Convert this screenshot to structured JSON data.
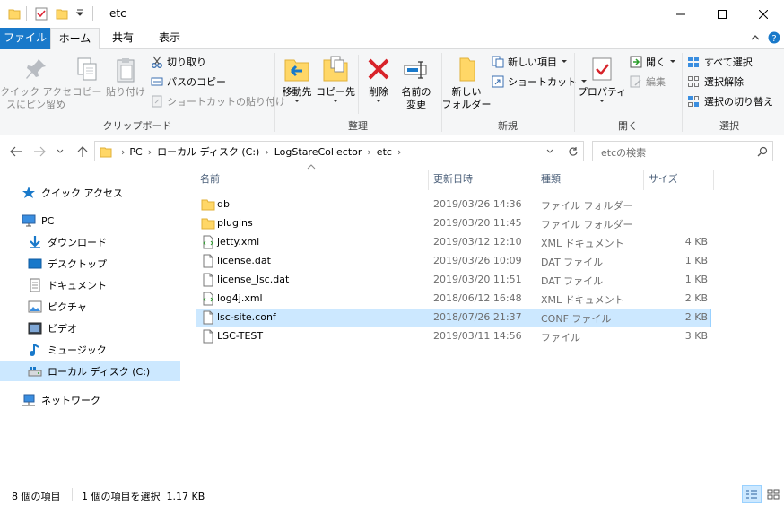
{
  "window": {
    "title": "etc"
  },
  "tabs": [
    "ファイル",
    "ホーム",
    "共有",
    "表示"
  ],
  "ribbon": {
    "clipboard": {
      "pin": "クイック アクセス\nスにピン留め",
      "pin_line1": "クイック アクセ",
      "pin_line2": "スにピン留め",
      "copy": "コピー",
      "paste": "貼り付け",
      "cut": "切り取り",
      "copy_path": "パスのコピー",
      "paste_shortcut": "ショートカットの貼り付け",
      "label": "クリップボード"
    },
    "organize": {
      "move_to": "移動先",
      "copy_to": "コピー先",
      "delete": "削除",
      "rename_line1": "名前の",
      "rename_line2": "変更",
      "label": "整理"
    },
    "new": {
      "new_folder_line1": "新しい",
      "new_folder_line2": "フォルダー",
      "new_item": "新しい項目",
      "shortcut": "ショートカット",
      "label": "新規"
    },
    "open": {
      "properties": "プロパティ",
      "open": "開く",
      "edit": "編集",
      "label": "開く"
    },
    "select": {
      "select_all": "すべて選択",
      "select_none": "選択解除",
      "invert": "選択の切り替え",
      "label": "選択"
    }
  },
  "address": {
    "crumbs": [
      "PC",
      "ローカル ディスク (C:)",
      "LogStareCollector",
      "etc"
    ],
    "search_placeholder": "etcの検索"
  },
  "sidebar": {
    "items": [
      {
        "label": "クイック アクセス",
        "icon": "star-icon"
      },
      {
        "label": "PC",
        "icon": "pc-icon"
      },
      {
        "label": "ダウンロード",
        "icon": "download-icon"
      },
      {
        "label": "デスクトップ",
        "icon": "desktop-icon"
      },
      {
        "label": "ドキュメント",
        "icon": "document-icon"
      },
      {
        "label": "ピクチャ",
        "icon": "picture-icon"
      },
      {
        "label": "ビデオ",
        "icon": "video-icon"
      },
      {
        "label": "ミュージック",
        "icon": "music-icon"
      },
      {
        "label": "ローカル ディスク (C:)",
        "icon": "drive-icon"
      },
      {
        "label": "ネットワーク",
        "icon": "network-icon"
      }
    ]
  },
  "columns": {
    "name": "名前",
    "date": "更新日時",
    "type": "種類",
    "size": "サイズ"
  },
  "files": [
    {
      "name": "db",
      "date": "2019/03/26 14:36",
      "type": "ファイル フォルダー",
      "size": "",
      "icon": "folder-icon"
    },
    {
      "name": "plugins",
      "date": "2019/03/20 11:45",
      "type": "ファイル フォルダー",
      "size": "",
      "icon": "folder-icon"
    },
    {
      "name": "jetty.xml",
      "date": "2019/03/12 12:10",
      "type": "XML ドキュメント",
      "size": "4 KB",
      "icon": "xml-file-icon"
    },
    {
      "name": "license.dat",
      "date": "2019/03/26 10:09",
      "type": "DAT ファイル",
      "size": "1 KB",
      "icon": "file-icon"
    },
    {
      "name": "license_lsc.dat",
      "date": "2019/03/20 11:51",
      "type": "DAT ファイル",
      "size": "1 KB",
      "icon": "file-icon"
    },
    {
      "name": "log4j.xml",
      "date": "2018/06/12 16:48",
      "type": "XML ドキュメント",
      "size": "2 KB",
      "icon": "xml-file-icon"
    },
    {
      "name": "lsc-site.conf",
      "date": "2018/07/26 21:37",
      "type": "CONF ファイル",
      "size": "2 KB",
      "icon": "file-icon",
      "selected": true
    },
    {
      "name": "LSC-TEST",
      "date": "2019/03/11 14:56",
      "type": "ファイル",
      "size": "3 KB",
      "icon": "file-icon"
    }
  ],
  "status": {
    "count": "8 個の項目",
    "selection": "1 個の項目を選択  1.17 KB"
  },
  "colors": {
    "accent": "#1979ca",
    "selection": "#cce8ff",
    "folder": "#ffd767"
  }
}
